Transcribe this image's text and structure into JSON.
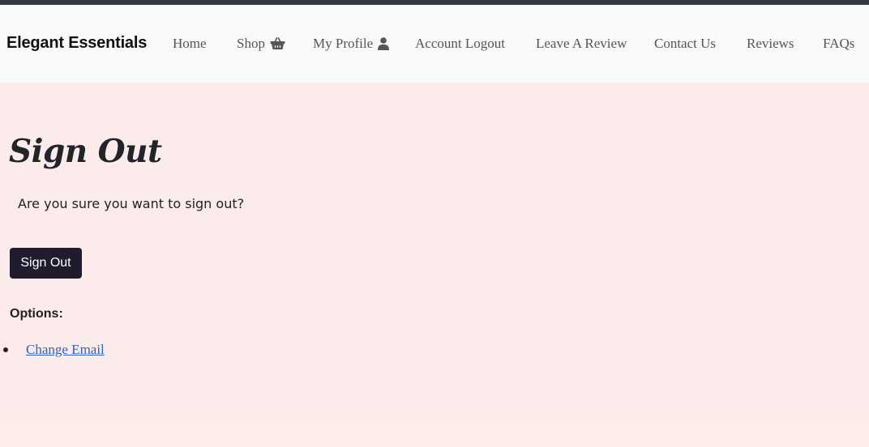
{
  "brand": "Elegant Essentials",
  "nav": {
    "home": "Home",
    "shop": "Shop",
    "profile": "My Profile",
    "logout": "Account Logout",
    "leave_review": "Leave A Review",
    "contact": "Contact Us",
    "reviews": "Reviews",
    "faqs": "FAQs"
  },
  "icons": {
    "shop": "basket-icon",
    "profile": "user-icon"
  },
  "main": {
    "title": "Sign Out",
    "question": "Are you sure you want to sign out?",
    "button_label": "Sign Out",
    "options_label": "Options:",
    "options": [
      "Change Email"
    ]
  },
  "colors": {
    "page_background": "#fcebeb",
    "navbar_background": "#f8f9fa",
    "button_background": "#211b2e",
    "link": "#2a62c9"
  }
}
